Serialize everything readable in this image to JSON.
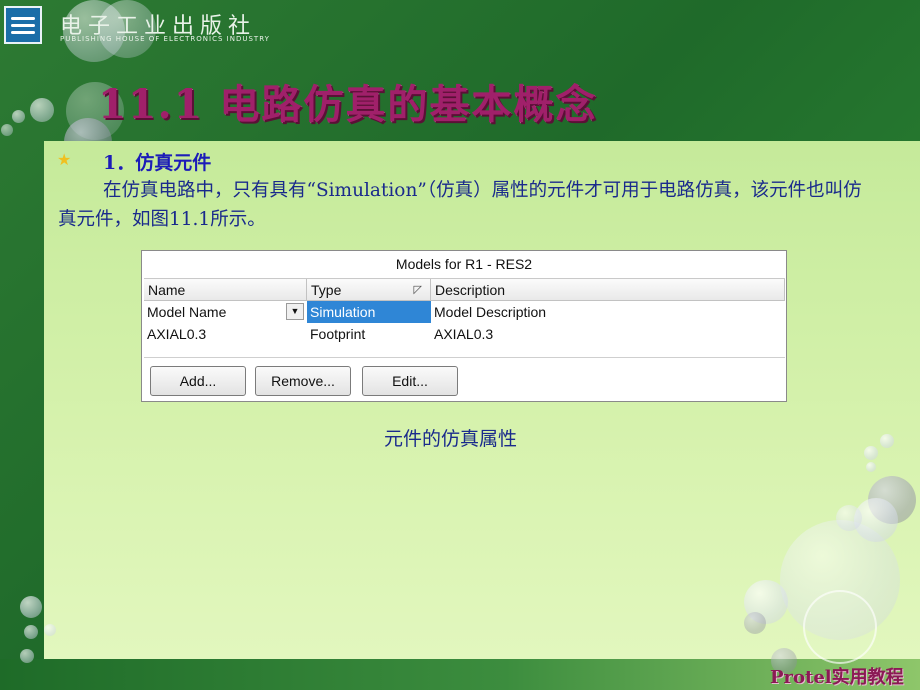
{
  "publisher": {
    "name_cn": "电子工业出版社",
    "name_en": "PUBLISHING HOUSE OF ELECTRONICS INDUSTRY",
    "logo_icon": "publisher-logo-icon"
  },
  "slide": {
    "title": "11.1  电路仿真的基本概念",
    "section_heading": "1．仿真元件",
    "bullet_icon": "star-bullet-icon",
    "paragraph": "在仿真电路中，只有具有“Simulation”（仿真）属性的元件才可用于电路仿真，该元件也叫仿真元件，如图11.1所示。",
    "caption": "元件的仿真属性",
    "footer_brand": "Protel实用教程"
  },
  "dialog": {
    "title": "Models for R1 - RES2",
    "columns": [
      "Name",
      "Type",
      "Description"
    ],
    "rows": [
      {
        "name": "Model Name",
        "type": "Simulation",
        "description": "Model Description",
        "selected_type": true
      },
      {
        "name": "AXIAL0.3",
        "type": "Footprint",
        "description": "AXIAL0.3",
        "selected_type": false
      }
    ],
    "buttons": {
      "add": "Add...",
      "remove": "Remove...",
      "edit": "Edit..."
    }
  },
  "colors": {
    "background_green": "#2d7a33",
    "panel_green": "#d6f2ad",
    "title_magenta": "#a0206a",
    "text_blue": "#1a2a8c",
    "selection_blue": "#2f86d6"
  }
}
